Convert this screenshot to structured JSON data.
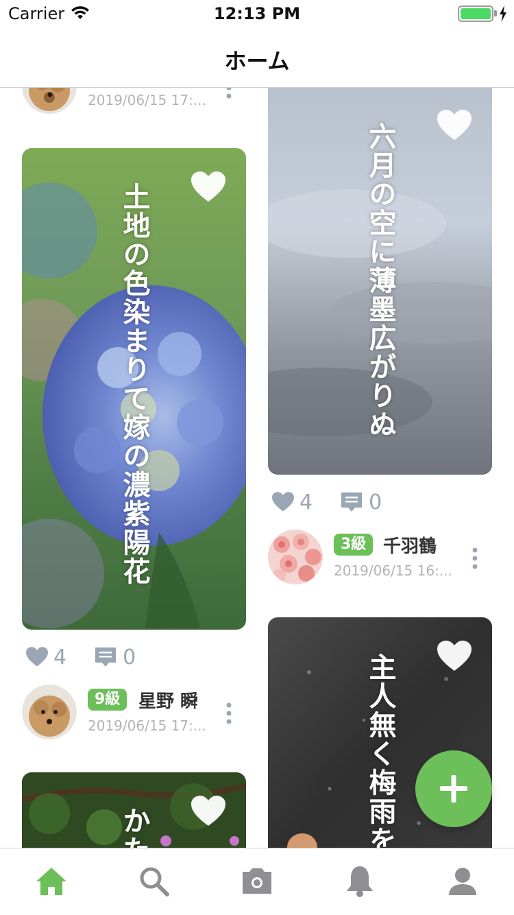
{
  "status_bar": {
    "carrier": "Carrier",
    "time": "12:13 PM",
    "battery_level": 1.0
  },
  "nav": {
    "title": "ホーム"
  },
  "colors": {
    "accent_green": "#6cbf59",
    "icon_gray": "#9aa6b4",
    "tab_inactive": "#8e8e93"
  },
  "posts": [
    {
      "id": "top-left-partial",
      "date": "2019/06/15 17:..."
    },
    {
      "id": "hydrangea",
      "poem": "土地の色染まりて嫁の濃紫陽花",
      "likes": "4",
      "comments": "0",
      "user": {
        "level": "9級",
        "name": "星野 瞬",
        "date": "2019/06/15 17:..."
      }
    },
    {
      "id": "bottom-left-partial",
      "poem": "かた"
    },
    {
      "id": "sky",
      "poem": "六月の空に薄墨広がりぬ",
      "likes": "4",
      "comments": "0",
      "user": {
        "level": "3級",
        "name": "千羽鶴",
        "date": "2019/06/15 16:..."
      }
    },
    {
      "id": "rain",
      "poem": "主人無く梅雨を"
    }
  ],
  "icons": {
    "like": "heart-icon",
    "comment": "comment-icon",
    "more": "more-vertical-icon",
    "fab": "plus-icon"
  },
  "tabs": [
    {
      "name": "home",
      "icon": "home-icon",
      "active": true
    },
    {
      "name": "search",
      "icon": "search-icon",
      "active": false
    },
    {
      "name": "camera",
      "icon": "camera-icon",
      "active": false
    },
    {
      "name": "notifications",
      "icon": "bell-icon",
      "active": false
    },
    {
      "name": "profile",
      "icon": "person-icon",
      "active": false
    }
  ]
}
